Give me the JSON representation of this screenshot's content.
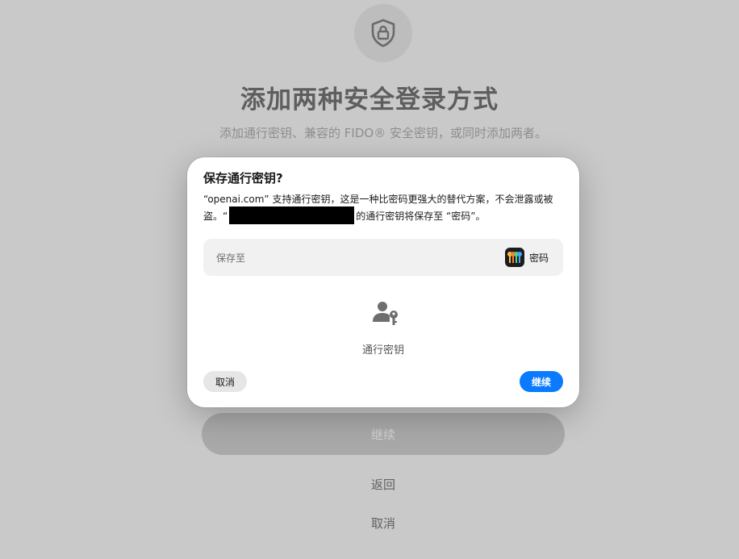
{
  "background": {
    "icon": "shield-lock-icon",
    "title": "添加两种安全登录方式",
    "subtitle": "添加通行密钥、兼容的 FIDO® 安全密钥，或同时添加两者。",
    "continue_label": "继续",
    "back_label": "返回",
    "cancel_label": "取消"
  },
  "dialog": {
    "title": "保存通行密钥?",
    "body_part1": "“openai.com” 支持通行密钥，这是一种比密码更强大的替代方案，不会泄露或被盗。“",
    "body_part2": "的通行密钥将保存至 “密码”。",
    "save_to_label": "保存至",
    "save_to_app": "密码",
    "save_to_app_icon": "passwords-app-icon",
    "passkey_icon": "person-key-icon",
    "passkey_label": "通行密钥",
    "cancel_label": "取消",
    "continue_label": "继续"
  },
  "colors": {
    "accent": "#0a7bff",
    "overlay_background": "#c9c9c9",
    "dialog_background": "#ffffff"
  }
}
